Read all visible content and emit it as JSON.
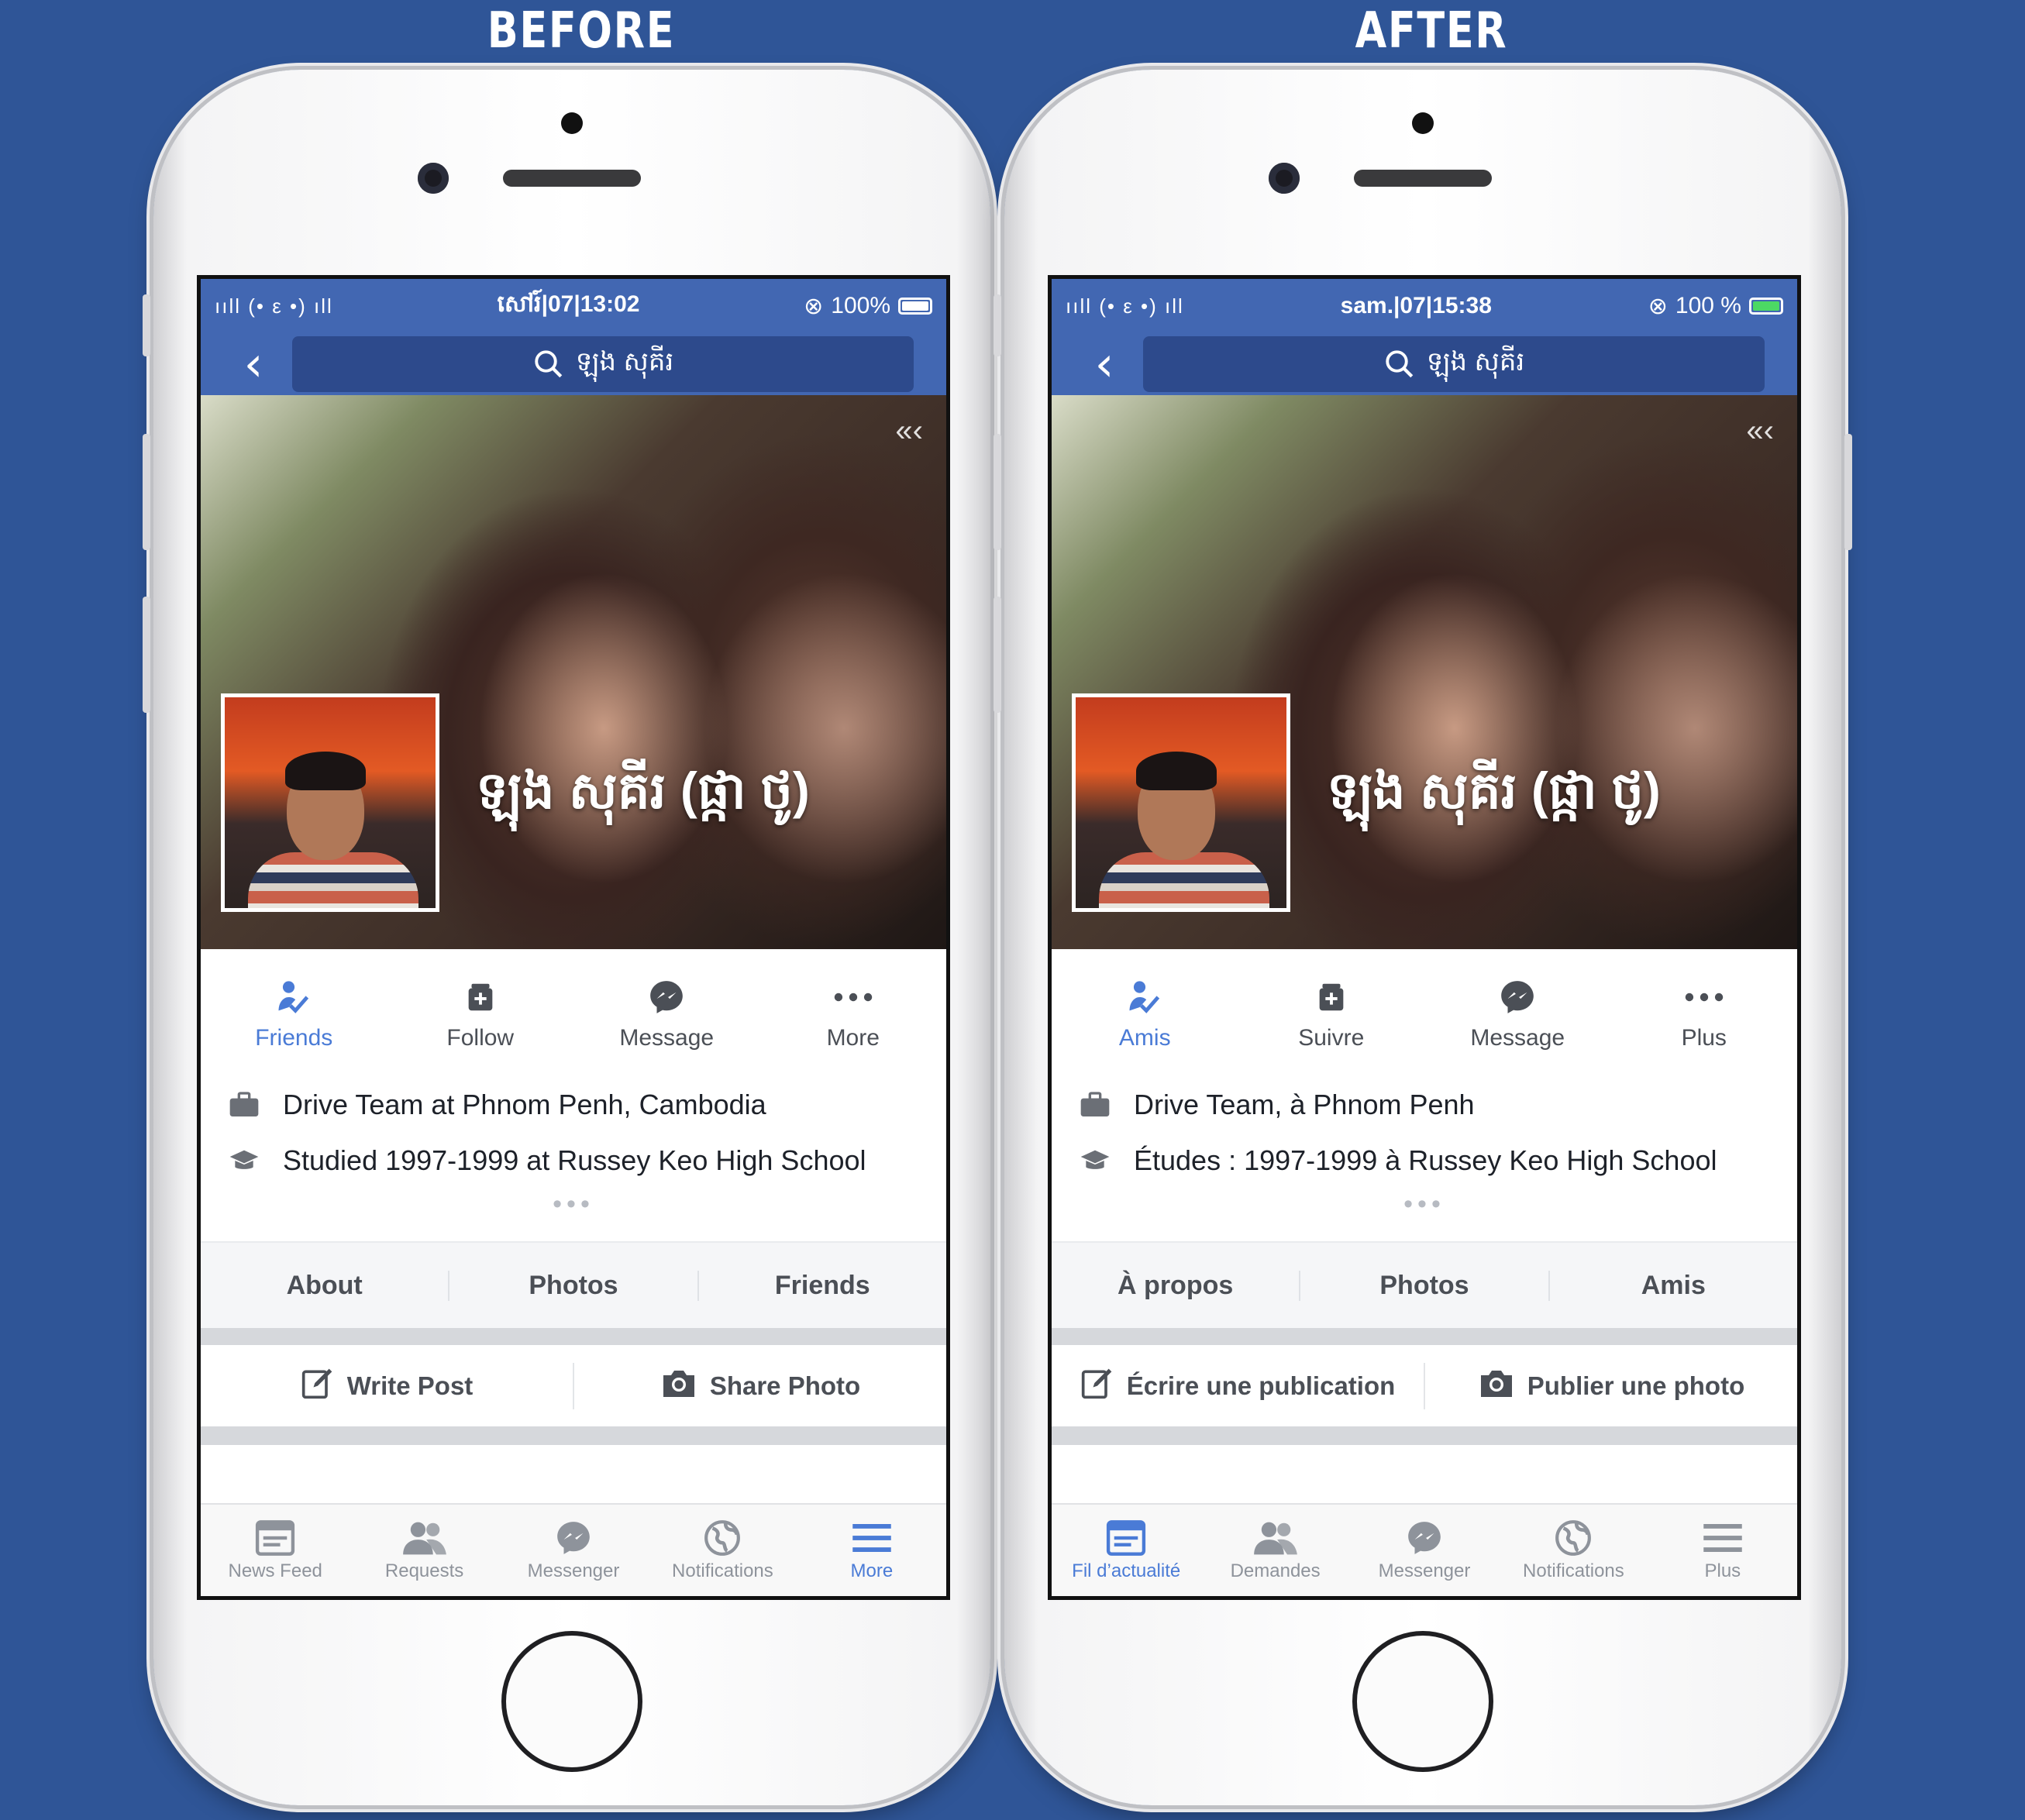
{
  "captions": {
    "before": "BEFORE",
    "after": "AFTER"
  },
  "colors": {
    "background": "#2f5597",
    "fb_blue": "#4267b2",
    "active_blue": "#4a7bd6",
    "battery_green": "#4cd964"
  },
  "phones": [
    {
      "status": {
        "signal": "ııll (• ε •) ıll",
        "time": "សៅរ៍|07|13:02",
        "battery": "100%"
      },
      "search": {
        "query": "ឡុង សុគីរ",
        "icon": "search-icon"
      },
      "profile_name": "ឡុង សុគីរ (ផ្កា ថូ)",
      "actions": [
        {
          "label": "Friends",
          "icon": "friends-check-icon"
        },
        {
          "label": "Follow",
          "icon": "follow-icon"
        },
        {
          "label": "Message",
          "icon": "messenger-icon"
        },
        {
          "label": "More",
          "icon": "more-dots-icon"
        }
      ],
      "info": [
        {
          "text": "Drive Team at Phnom Penh, Cambodia",
          "icon": "briefcase-icon"
        },
        {
          "text": "Studied 1997-1999 at Russey Keo High School",
          "icon": "graduation-cap-icon"
        }
      ],
      "info_more": "•••",
      "tabs": [
        "About",
        "Photos",
        "Friends"
      ],
      "composer": [
        {
          "label": "Write Post",
          "icon": "edit-icon"
        },
        {
          "label": "Share Photo",
          "icon": "camera-icon"
        }
      ],
      "tabbar": [
        {
          "label": "News Feed",
          "icon": "news-feed-icon"
        },
        {
          "label": "Requests",
          "icon": "requests-icon"
        },
        {
          "label": "Messenger",
          "icon": "messenger-icon"
        },
        {
          "label": "Notifications",
          "icon": "globe-icon"
        },
        {
          "label": "More",
          "icon": "menu-icon"
        }
      ],
      "active_tab": 4
    },
    {
      "status": {
        "signal": "ııll (• ε •) ıll",
        "time": "sam.|07|15:38",
        "battery": "100 %"
      },
      "search": {
        "query": "ឡុង សុគីរ",
        "icon": "search-icon"
      },
      "profile_name": "ឡុង សុគីរ (ផ្កា ថូ)",
      "actions": [
        {
          "label": "Amis",
          "icon": "friends-check-icon"
        },
        {
          "label": "Suivre",
          "icon": "follow-icon"
        },
        {
          "label": "Message",
          "icon": "messenger-icon"
        },
        {
          "label": "Plus",
          "icon": "more-dots-icon"
        }
      ],
      "info": [
        {
          "text": "Drive Team, à Phnom Penh",
          "icon": "briefcase-icon"
        },
        {
          "text": "Études : 1997-1999 à Russey Keo High School",
          "icon": "graduation-cap-icon"
        }
      ],
      "info_more": "•••",
      "tabs": [
        "À propos",
        "Photos",
        "Amis"
      ],
      "composer": [
        {
          "label": "Écrire une publication",
          "icon": "edit-icon"
        },
        {
          "label": "Publier une photo",
          "icon": "camera-icon"
        }
      ],
      "tabbar": [
        {
          "label": "Fil d’actualité",
          "icon": "news-feed-icon"
        },
        {
          "label": "Demandes",
          "icon": "requests-icon"
        },
        {
          "label": "Messenger",
          "icon": "messenger-icon"
        },
        {
          "label": "Notifications",
          "icon": "globe-icon"
        },
        {
          "label": "Plus",
          "icon": "menu-icon"
        }
      ],
      "active_tab": 0
    }
  ]
}
